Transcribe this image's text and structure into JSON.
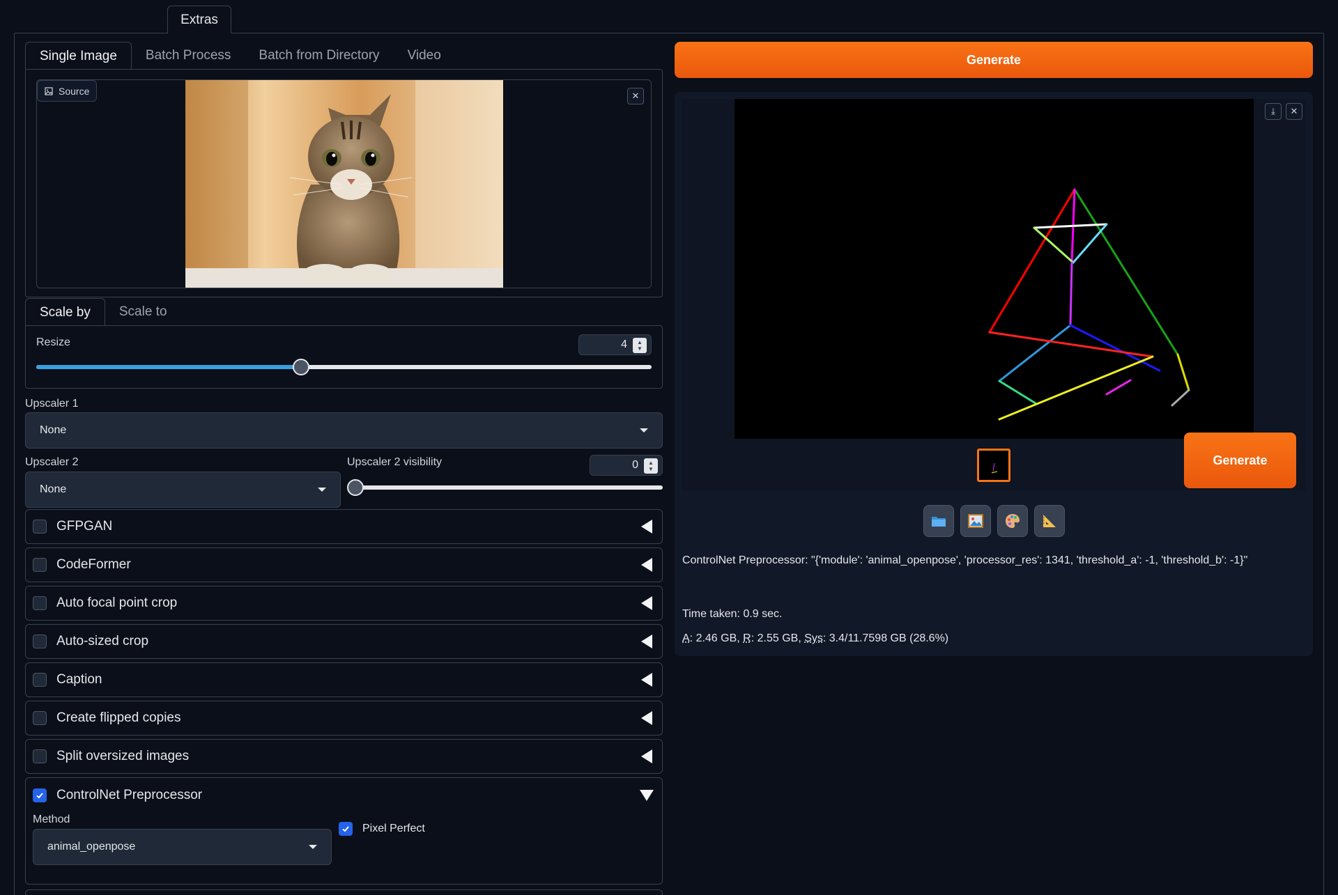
{
  "top_tab": {
    "label": "Extras"
  },
  "image_tabs": [
    "Single Image",
    "Batch Process",
    "Batch from Directory",
    "Video"
  ],
  "source": {
    "label": "Source"
  },
  "scale_tabs": [
    "Scale by",
    "Scale to"
  ],
  "resize": {
    "label": "Resize",
    "value": "4",
    "fraction": 0.43
  },
  "upscaler1": {
    "label": "Upscaler 1",
    "value": "None"
  },
  "upscaler2": {
    "label": "Upscaler 2",
    "value": "None"
  },
  "upscaler2_visibility": {
    "label": "Upscaler 2 visibility",
    "value": "0",
    "fraction": 0
  },
  "accordions": [
    {
      "label": "GFPGAN",
      "checked": false
    },
    {
      "label": "CodeFormer",
      "checked": false
    },
    {
      "label": "Auto focal point crop",
      "checked": false
    },
    {
      "label": "Auto-sized crop",
      "checked": false
    },
    {
      "label": "Caption",
      "checked": false
    },
    {
      "label": "Create flipped copies",
      "checked": false
    },
    {
      "label": "Split oversized images",
      "checked": false
    }
  ],
  "controlnet": {
    "label": "ControlNet Preprocessor",
    "checked": true,
    "method_label": "Method",
    "method_value": "animal_openpose",
    "pixel_perfect_label": "Pixel Perfect"
  },
  "generate": {
    "label": "Generate"
  },
  "generate_overlay": {
    "label": "Generate"
  },
  "output": {
    "info_text": "ControlNet Preprocessor: \"{'module': 'animal_openpose', 'processor_res': 1341, 'threshold_a': -1, 'threshold_b': -1}\"",
    "time_taken": "Time taken: 0.9 sec.",
    "mem_a": "A",
    "mem_a_rest": ": 2.46 GB, ",
    "mem_r": "R",
    "mem_r_rest": ": 2.55 GB, ",
    "mem_sys": "Sys",
    "mem_sys_rest": ": 3.4/11.7598 GB (28.6%)"
  },
  "tool_buttons": [
    "folder-icon",
    "image-icon",
    "palette-icon",
    "ruler-icon"
  ],
  "colors": {
    "accent": "#f97316",
    "checkbox": "#2563eb",
    "slider_fill": "#3b9ede"
  }
}
